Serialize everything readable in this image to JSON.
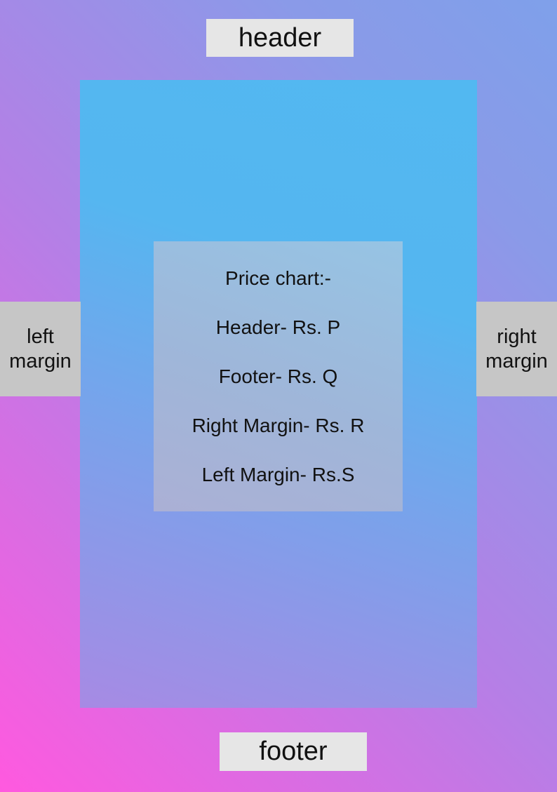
{
  "header": {
    "label": "header"
  },
  "footer": {
    "label": "footer"
  },
  "margins": {
    "left": {
      "line1": "left",
      "line2": "margin"
    },
    "right": {
      "line1": "right",
      "line2": "margin"
    }
  },
  "price_chart": {
    "title": "Price chart:-",
    "items": [
      "Header- Rs. P",
      "Footer- Rs. Q",
      "Right Margin- Rs. R",
      "Left Margin- Rs.S"
    ]
  },
  "colors": {
    "background_start": "#ff59df",
    "background_end": "#7fa0ea",
    "page_top": "#52b8f1",
    "page_bottom": "#a78ae4",
    "label_box": "#e6e6e6",
    "margin_box": "#c6c6c6"
  }
}
